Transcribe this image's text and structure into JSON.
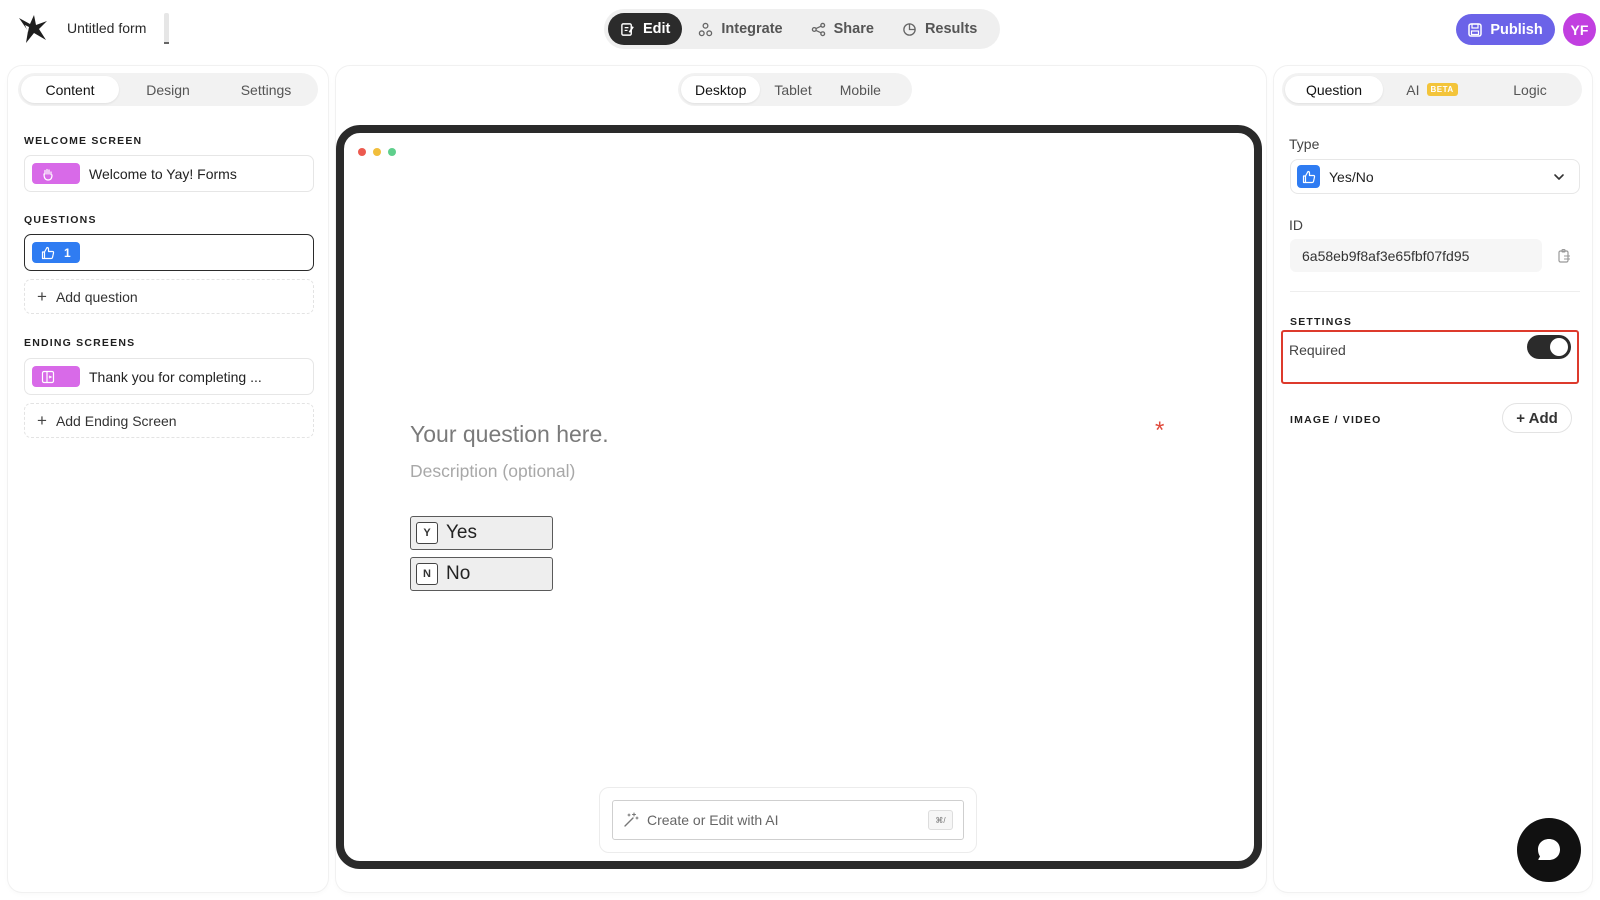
{
  "header": {
    "form_title": "Untitled form",
    "nav": [
      {
        "label": "Edit",
        "icon": "edit-icon",
        "active": true
      },
      {
        "label": "Integrate",
        "icon": "integrate-icon",
        "active": false
      },
      {
        "label": "Share",
        "icon": "share-icon",
        "active": false
      },
      {
        "label": "Results",
        "icon": "results-icon",
        "active": false
      }
    ],
    "publish_label": "Publish",
    "avatar_initials": "YF"
  },
  "left_panel": {
    "tabs": [
      {
        "label": "Content",
        "active": true
      },
      {
        "label": "Design",
        "active": false
      },
      {
        "label": "Settings",
        "active": false
      }
    ],
    "welcome_section": "WELCOME SCREEN",
    "welcome_item": "Welcome to Yay! Forms",
    "questions_section": "QUESTIONS",
    "question_number": "1",
    "add_question": "Add question",
    "ending_section": "ENDING SCREENS",
    "ending_item": "Thank you for completing ...",
    "add_ending": "Add Ending Screen"
  },
  "center": {
    "device_tabs": [
      {
        "label": "Desktop",
        "active": true
      },
      {
        "label": "Tablet",
        "active": false
      },
      {
        "label": "Mobile",
        "active": false
      }
    ],
    "question_placeholder": "Your question here.",
    "required_marker": "*",
    "description_placeholder": "Description (optional)",
    "choices": [
      {
        "key": "Y",
        "label": "Yes"
      },
      {
        "key": "N",
        "label": "No"
      }
    ],
    "ai_placeholder": "Create or Edit with AI",
    "ai_shortcut": "⌘/"
  },
  "right_panel": {
    "tabs": [
      {
        "label": "Question",
        "active": true
      },
      {
        "label": "AI",
        "badge": "BETA",
        "active": false
      },
      {
        "label": "Logic",
        "active": false
      }
    ],
    "type_label": "Type",
    "type_value": "Yes/No",
    "id_label": "ID",
    "id_value": "6a58eb9f8af3e65fbf07fd95",
    "settings_section": "SETTINGS",
    "required_label": "Required",
    "required_on": true,
    "media_section": "IMAGE / VIDEO",
    "add_media": "+ Add"
  },
  "colors": {
    "accent": "#6b63e8",
    "avatar": "#c13fe0",
    "chip_purple": "#d86ae8",
    "chip_blue": "#2f7cf2",
    "highlight_red": "#dd3a2c"
  }
}
